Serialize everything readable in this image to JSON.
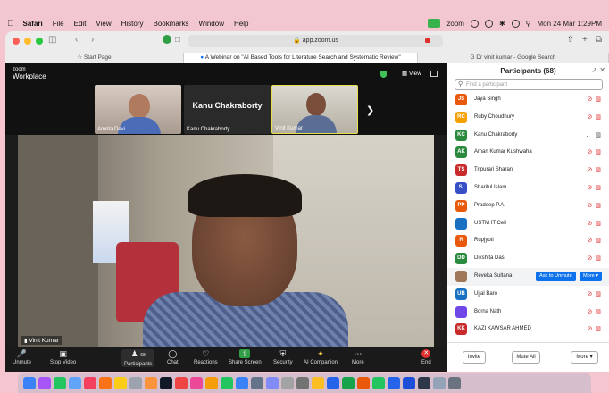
{
  "menubar": {
    "app": "Safari",
    "items": [
      "File",
      "Edit",
      "View",
      "History",
      "Bookmarks",
      "Window",
      "Help"
    ],
    "zoom_label": "zoom",
    "datetime": "Mon 24 Mar 1:29PM"
  },
  "browser": {
    "url": "app.zoom.us",
    "tabs": [
      {
        "label": "Start Page"
      },
      {
        "label": "A Webinar on \"AI Based Tools for Literature Search and Systematic Review\""
      },
      {
        "label": "Dr vinit kumar - Google Search"
      }
    ]
  },
  "zoom": {
    "logo_line1": "zoom",
    "logo_line2": "Workplace",
    "view_label": "View",
    "thumbnails": [
      {
        "name": "Amrita Devi"
      },
      {
        "name": "Kanu Chakraborty",
        "label": "Kanu Chakraborty"
      },
      {
        "name": "Vinit Kumar"
      }
    ],
    "main_speaker": "Vinit Kumar",
    "controls": {
      "unmute": "Unmute",
      "stop_video": "Stop Video",
      "participants": "Participants",
      "participants_count": "68",
      "chat": "Chat",
      "reactions": "Reactions",
      "share_screen": "Share Screen",
      "security": "Security",
      "ai_companion": "AI Companion",
      "more": "More",
      "end": "End"
    }
  },
  "participants_panel": {
    "title": "Participants (68)",
    "search_placeholder": "Find a participant",
    "participants": [
      {
        "initials": "JS",
        "name": "Jaya Singh",
        "color": "#e8590c",
        "muted": true
      },
      {
        "initials": "RC",
        "name": "Ruby Choudhury",
        "color": "#f59f00",
        "muted": true
      },
      {
        "initials": "KC",
        "name": "Kanu Chakraborty",
        "color": "#2b8a3e",
        "muted": false
      },
      {
        "initials": "AK",
        "name": "Aman Kumar Kushwaha",
        "color": "#2b8a3e",
        "muted": true
      },
      {
        "initials": "TS",
        "name": "Tripurari Sharan",
        "color": "#c92a2a",
        "muted": true
      },
      {
        "initials": "SI",
        "name": "Shariful Islam",
        "color": "#364fc7",
        "muted": true
      },
      {
        "initials": "PP",
        "name": "Pradeep P.A.",
        "color": "#e8590c",
        "muted": true
      },
      {
        "initials": "",
        "name": "USTM IT Cell",
        "color": "#1971c2",
        "muted": true
      },
      {
        "initials": "R",
        "name": "Rupjyoti",
        "color": "#e8590c",
        "muted": true
      },
      {
        "initials": "DD",
        "name": "Dikshita Das",
        "color": "#2b8a3e",
        "muted": true
      },
      {
        "initials": "",
        "name": "Reveka Sultana",
        "color": "#a07857",
        "muted": true,
        "highlighted": true
      },
      {
        "initials": "UB",
        "name": "Ujjal Baro",
        "color": "#1971c2",
        "muted": true
      },
      {
        "initials": "",
        "name": "Borna Nath",
        "color": "#7048e8",
        "muted": true
      },
      {
        "initials": "KK",
        "name": "KAZI KAWSAR AHMED",
        "color": "#c92a2a",
        "muted": true
      }
    ],
    "ask_to_unmute": "Ask to Unmute",
    "row_more": "More",
    "footer": {
      "invite": "Invite",
      "mute_all": "Mute All",
      "more": "More"
    }
  },
  "dock": {
    "colors": [
      "#3b82f6",
      "#a855f7",
      "#22c55e",
      "#60a5fa",
      "#f43f5e",
      "#f97316",
      "#facc15",
      "#9ca3af",
      "#fb923c",
      "#111827",
      "#ef4444",
      "#ec4899",
      "#f59e0b",
      "#22c55e",
      "#3b82f6",
      "#64748b",
      "#818cf8",
      "#a3a3a3",
      "#737373",
      "#fbbf24",
      "#2563eb",
      "#16a34a",
      "#ea580c",
      "#22c55e",
      "#2563eb",
      "#1d4ed8",
      "#2d3748",
      "#94a3b8",
      "#6b7280"
    ]
  }
}
